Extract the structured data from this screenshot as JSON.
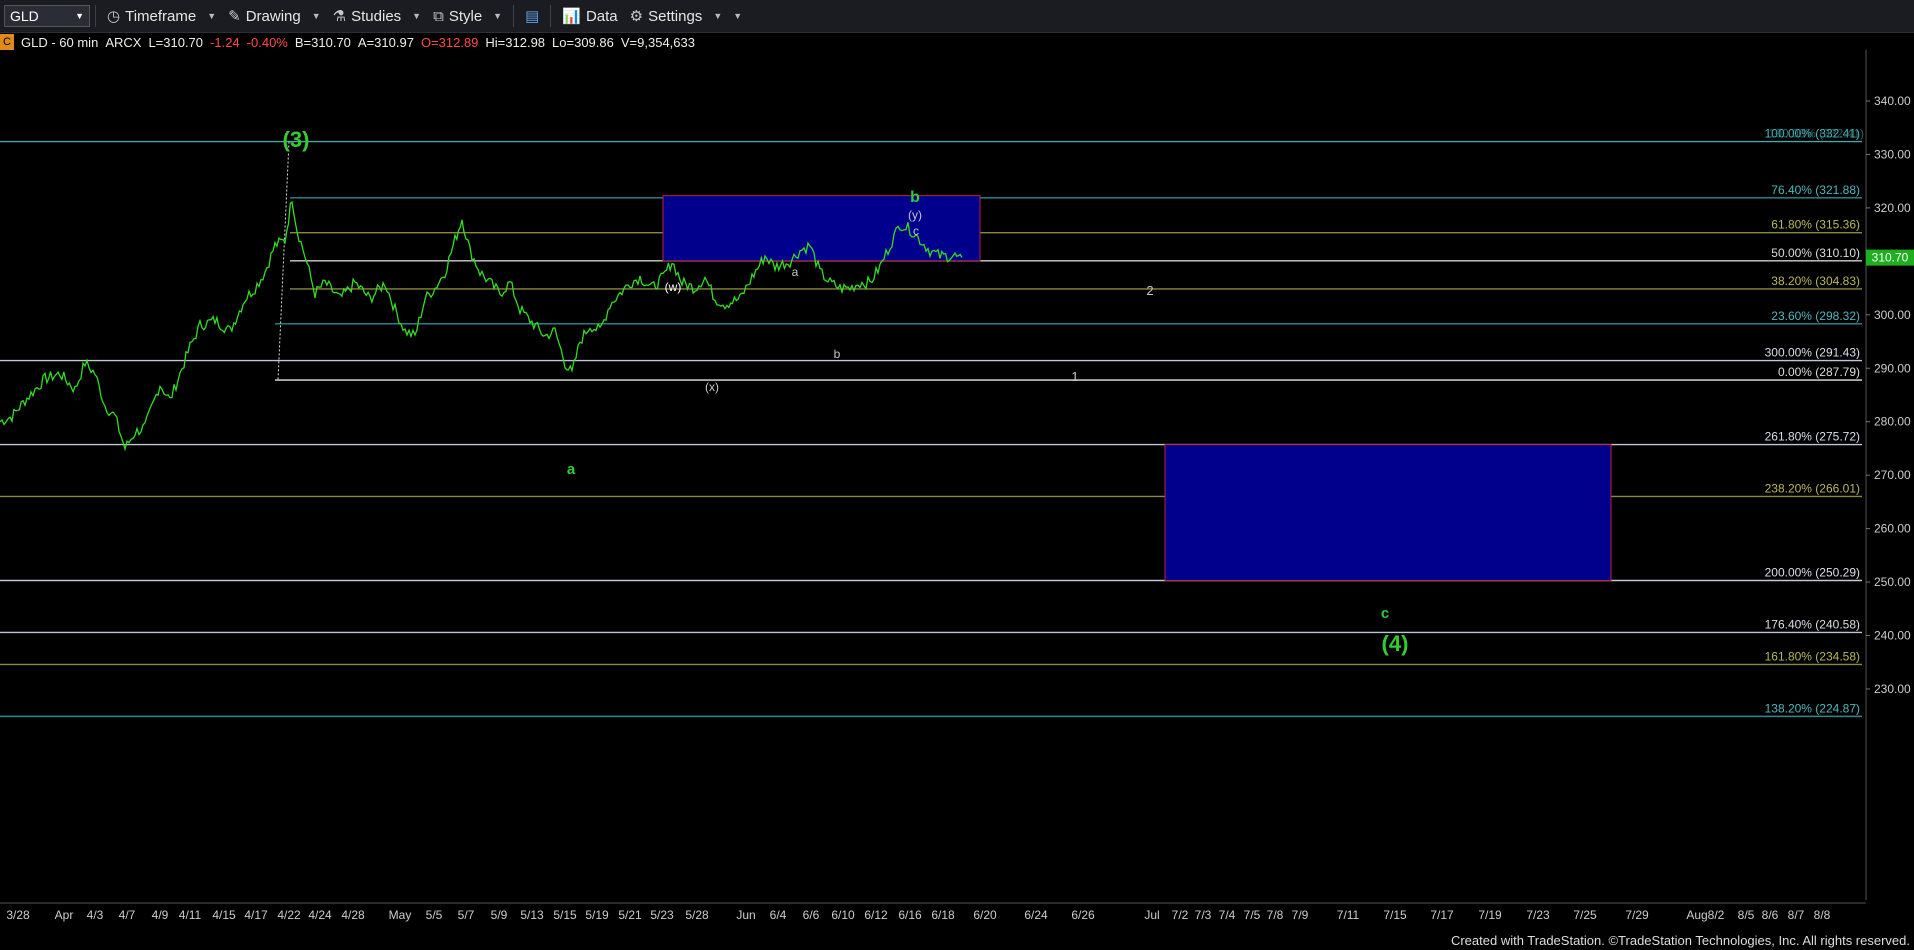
{
  "toolbar": {
    "symbol": "GLD",
    "timeframe": "Timeframe",
    "drawing": "Drawing",
    "studies": "Studies",
    "style": "Style",
    "data": "Data",
    "settings": "Settings"
  },
  "info": {
    "marker": "C",
    "title": "GLD - 60 min",
    "exchange": "ARCX",
    "last": "L=310.70",
    "change": "-1.24",
    "pct": "-0.40%",
    "bid": "B=310.70",
    "ask": "A=310.97",
    "open": "O=312.89",
    "hi": "Hi=312.98",
    "lo": "Lo=309.86",
    "vol": "V=9,354,633"
  },
  "price_axis": {
    "ticks": [
      "340.00",
      "330.00",
      "320.00",
      "310.00",
      "300.00",
      "290.00",
      "280.00",
      "270.00",
      "260.00",
      "250.00",
      "240.00",
      "230.00"
    ],
    "last_price": "310.70"
  },
  "date_axis": [
    "3/28",
    "Apr",
    "4/3",
    "4/7",
    "4/9",
    "4/11",
    "4/15",
    "4/17",
    "4/22",
    "4/24",
    "4/28",
    "May",
    "5/5",
    "5/7",
    "5/9",
    "5/13",
    "5/15",
    "5/19",
    "5/21",
    "5/23",
    "5/28",
    "Jun",
    "6/4",
    "6/6",
    "6/10",
    "6/12",
    "6/16",
    "6/18",
    "6/20",
    "6/24",
    "6/26",
    "Jul",
    "7/2",
    "7/3",
    "7/4",
    "7/5",
    "7/8",
    "7/9",
    "7/11",
    "7/15",
    "7/17",
    "7/19",
    "7/23",
    "7/25",
    "7/29",
    "Aug",
    "8/2",
    "8/5",
    "8/6",
    "8/7",
    "8/8"
  ],
  "fib_levels": [
    {
      "label": "100.00% (332.41)",
      "price": 332.41,
      "color": "#4aa3a8"
    },
    {
      "label": "76.40% (321.88)",
      "price": 321.88,
      "color": "#2e8a8f"
    },
    {
      "label": "61.80% (315.36)",
      "price": 315.36,
      "color": "#8a8a3a"
    },
    {
      "label": "50.00% (310.10)",
      "price": 310.1,
      "color": "#cfcfcf"
    },
    {
      "label": "38.20% (304.83)",
      "price": 304.83,
      "color": "#8a8a3a"
    },
    {
      "label": "23.60% (298.32)",
      "price": 298.32,
      "color": "#2e8a8f"
    },
    {
      "label": "300.00% (291.43)",
      "price": 291.43,
      "color": "#bfc6d8"
    },
    {
      "label": "0.00% (287.79)",
      "price": 287.79,
      "color": "#e6e6e6"
    },
    {
      "label": "261.80% (275.72)",
      "price": 275.72,
      "color": "#bfc6d8"
    },
    {
      "label": "238.20% (266.01)",
      "price": 266.01,
      "color": "#8a8a3a"
    },
    {
      "label": "200.00% (250.29)",
      "price": 250.29,
      "color": "#bfc6d8"
    },
    {
      "label": "176.40% (240.58)",
      "price": 240.58,
      "color": "#bfc6d8"
    },
    {
      "label": "161.80% (234.58)",
      "price": 234.58,
      "color": "#8a8a3a"
    },
    {
      "label": "138.20% (224.87)",
      "price": 224.87,
      "color": "#2e8a8f"
    }
  ],
  "wave_labels": [
    {
      "text": "(3)",
      "color": "#33cc33",
      "big": true
    },
    {
      "text": "b",
      "color": "#33cc33"
    },
    {
      "text": "(y)",
      "color": "#c8c8c8"
    },
    {
      "text": "c",
      "color": "#c8c8c8"
    },
    {
      "text": "(w)",
      "color": "#ffffff"
    },
    {
      "text": "a",
      "color": "#c8c8c8"
    },
    {
      "text": "b",
      "color": "#c8c8c8"
    },
    {
      "text": "(x)",
      "color": "#c8c8c8"
    },
    {
      "text": "a",
      "color": "#33cc33"
    },
    {
      "text": "2",
      "color": "#c8c8c8"
    },
    {
      "text": "1",
      "color": "#c8c8c8"
    },
    {
      "text": "c",
      "color": "#33cc33"
    },
    {
      "text": "(4)",
      "color": "#33cc33",
      "big": true
    }
  ],
  "colors": {
    "price": "#33dd22",
    "box_fill": "#00008c",
    "box_border": "#c0203a",
    "last_price_bg": "#1fae1f"
  },
  "footer": {
    "credit": "Created with TradeStation. ©TradeStation Technologies, Inc. All rights reserved."
  }
}
